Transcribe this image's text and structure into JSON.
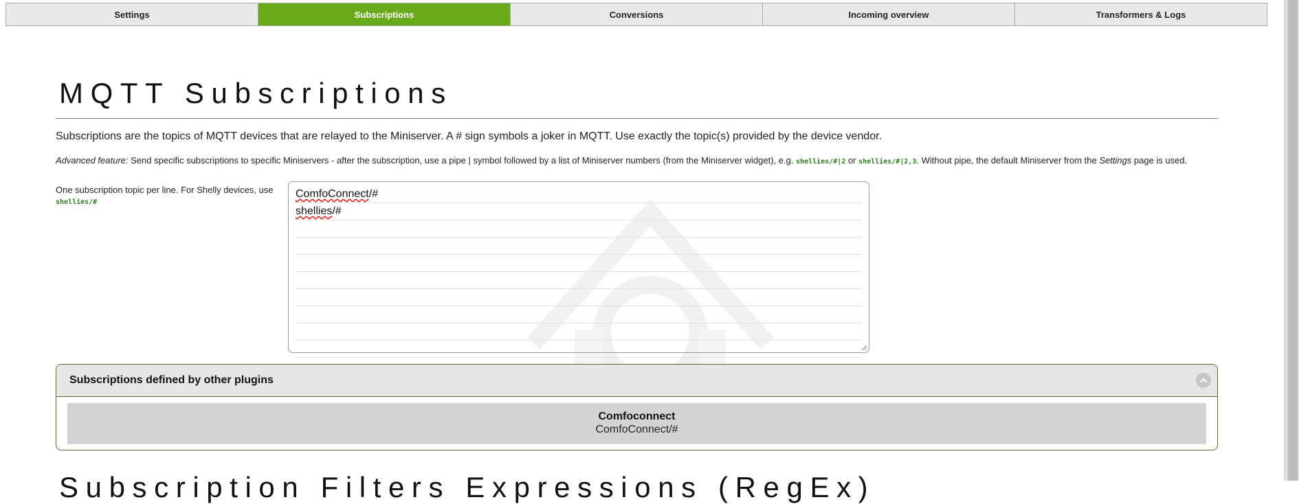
{
  "tabs": [
    {
      "label": "Settings",
      "active": false
    },
    {
      "label": "Subscriptions",
      "active": true
    },
    {
      "label": "Conversions",
      "active": false
    },
    {
      "label": "Incoming overview",
      "active": false
    },
    {
      "label": "Transformers & Logs",
      "active": false
    }
  ],
  "page": {
    "title": "MQTT Subscriptions",
    "intro": "Subscriptions are the topics of MQTT devices that are relayed to the Miniserver. A # sign symbols a joker in MQTT. Use exactly the topic(s) provided by the device vendor.",
    "advanced": {
      "label": "Advanced feature:",
      "text1": " Send specific subscriptions to specific Miniservers - after the subscription, use a pipe | symbol followed by a list of Miniserver numbers (from the Miniserver widget), e.g. ",
      "example1": "shellies/#|2",
      "or": " or ",
      "example2": "shellies/#|2,3",
      "text2": ". Without pipe, the default Miniserver from the ",
      "settings_word": "Settings",
      "text3": " page is used."
    },
    "field_label": "One subscription topic per line. For Shelly devices, use",
    "field_label_code": "shellies/#",
    "topics": {
      "line1_a": "ComfoConnect",
      "line1_b": "/#",
      "line2_a": "shellies",
      "line2_b": "/#"
    },
    "other_plugins": {
      "header": "Subscriptions defined by other plugins",
      "plugin_name": "Comfoconnect",
      "plugin_topic": "ComfoConnect/#"
    },
    "next_heading": "Subscription Filters Expressions (RegEx)"
  },
  "colors": {
    "active_tab": "#6aa81c",
    "code_green": "#2d7a1e",
    "panel_border": "#5b6b2e"
  }
}
